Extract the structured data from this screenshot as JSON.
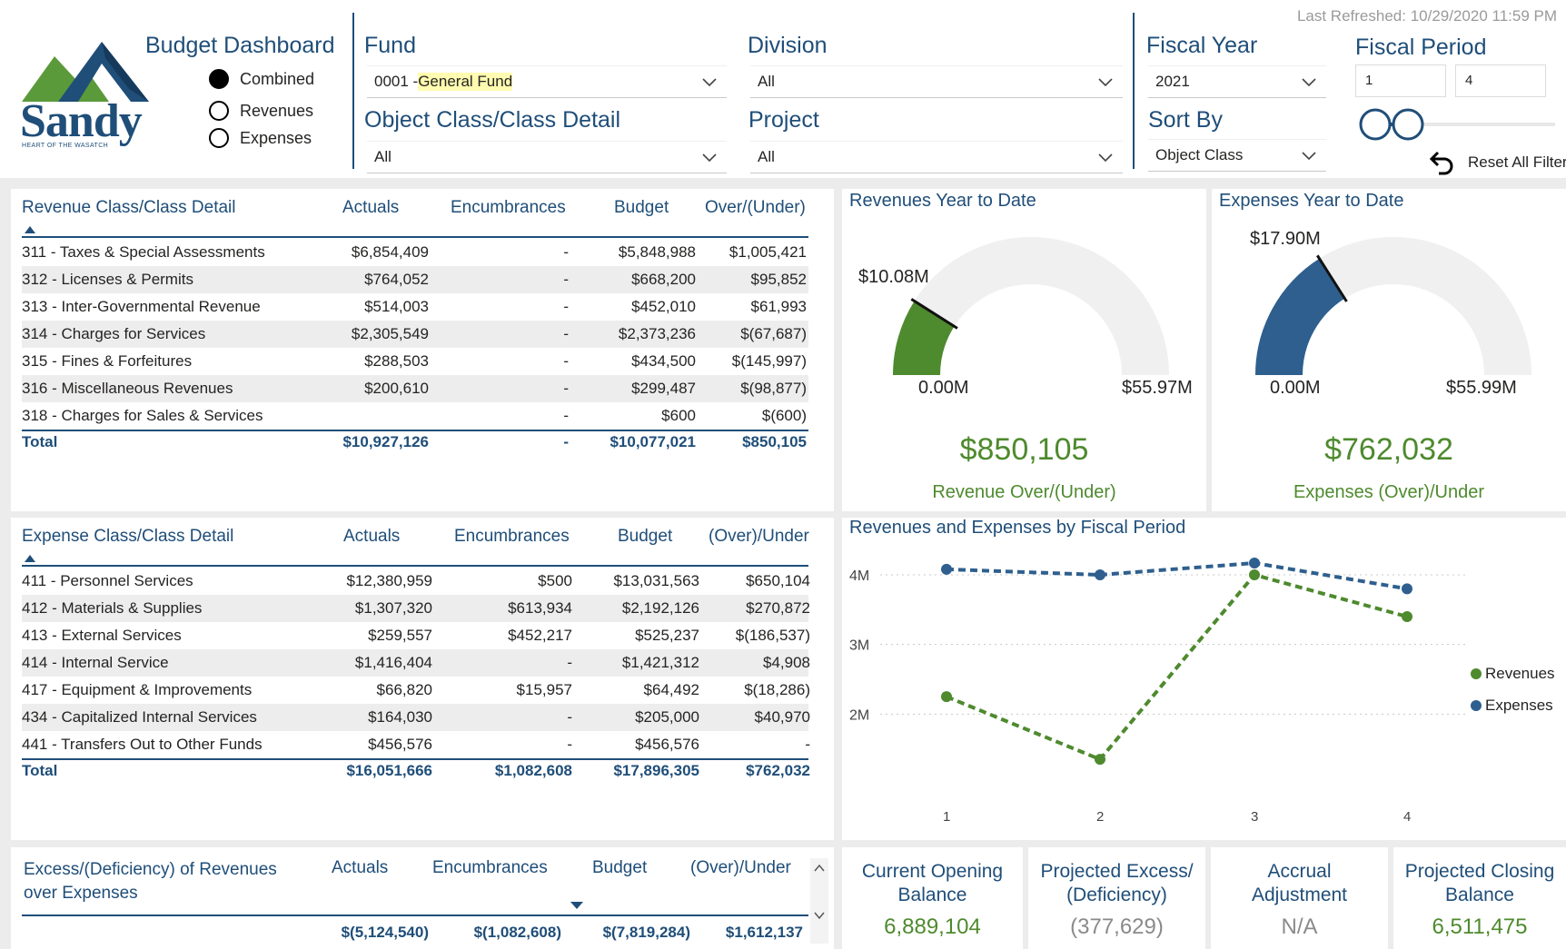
{
  "header": {
    "logo_text": "Sandy",
    "logo_tagline": "HEART OF THE WASATCH",
    "dashboard_title": "Budget Dashboard",
    "view_options": [
      {
        "label": "Combined",
        "selected": true
      },
      {
        "label": "Revenues",
        "selected": false
      },
      {
        "label": "Expenses",
        "selected": false
      }
    ],
    "last_refreshed": "Last Refreshed: 10/29/2020 11:59 PM"
  },
  "filters": {
    "fund": {
      "label": "Fund",
      "value_prefix": "0001 - ",
      "value_highlight": "General Fund"
    },
    "division": {
      "label": "Division",
      "value": "All"
    },
    "object_class": {
      "label": "Object Class/Class Detail",
      "value": "All"
    },
    "project": {
      "label": "Project",
      "value": "All"
    },
    "fiscal_year": {
      "label": "Fiscal Year",
      "value": "2021"
    },
    "sort_by": {
      "label": "Sort By",
      "value": "Object Class"
    },
    "fiscal_period": {
      "label": "Fiscal Period",
      "from": "1",
      "to": "4"
    },
    "reset_label": "Reset All Filters"
  },
  "revenue_table": {
    "headers": [
      "Revenue Class/Class Detail",
      "Actuals",
      "Encumbrances",
      "Budget",
      "Over/(Under)"
    ],
    "rows": [
      [
        "311 - Taxes & Special Assessments",
        "$6,854,409",
        "-",
        "$5,848,988",
        "$1,005,421"
      ],
      [
        "312 - Licenses & Permits",
        "$764,052",
        "-",
        "$668,200",
        "$95,852"
      ],
      [
        "313 - Inter-Governmental Revenue",
        "$514,003",
        "-",
        "$452,010",
        "$61,993"
      ],
      [
        "314 - Charges for Services",
        "$2,305,549",
        "-",
        "$2,373,236",
        "$(67,687)"
      ],
      [
        "315 - Fines & Forfeitures",
        "$288,503",
        "-",
        "$434,500",
        "$(145,997)"
      ],
      [
        "316 - Miscellaneous Revenues",
        "$200,610",
        "-",
        "$299,487",
        "$(98,877)"
      ],
      [
        "318 - Charges for Sales & Services",
        "",
        "-",
        "$600",
        "$(600)"
      ]
    ],
    "total": [
      "Total",
      "$10,927,126",
      "-",
      "$10,077,021",
      "$850,105"
    ]
  },
  "expense_table": {
    "headers": [
      "Expense Class/Class Detail",
      "Actuals",
      "Encumbrances",
      "Budget",
      "(Over)/Under"
    ],
    "rows": [
      [
        "411 - Personnel Services",
        "$12,380,959",
        "$500",
        "$13,031,563",
        "$650,104"
      ],
      [
        "412 - Materials & Supplies",
        "$1,307,320",
        "$613,934",
        "$2,192,126",
        "$270,872"
      ],
      [
        "413 - External Services",
        "$259,557",
        "$452,217",
        "$525,237",
        "$(186,537)"
      ],
      [
        "414 - Internal Service",
        "$1,416,404",
        "-",
        "$1,421,312",
        "$4,908"
      ],
      [
        "417 - Equipment & Improvements",
        "$66,820",
        "$15,957",
        "$64,492",
        "$(18,286)"
      ],
      [
        "434 - Capitalized Internal Services",
        "$164,030",
        "-",
        "$205,000",
        "$40,970"
      ],
      [
        "441 - Transfers Out to Other Funds",
        "$456,576",
        "-",
        "$456,576",
        "-"
      ]
    ],
    "total": [
      "Total",
      "$16,051,666",
      "$1,082,608",
      "$17,896,305",
      "$762,032"
    ]
  },
  "excess_table": {
    "title_line1": "Excess/(Deficiency) of Revenues",
    "title_line2": "over Expenses",
    "headers": [
      "Actuals",
      "Encumbrances",
      "Budget",
      "(Over)/Under"
    ],
    "total": [
      "$(5,124,540)",
      "$(1,082,608)",
      "$(7,819,284)",
      "$1,612,137"
    ]
  },
  "revenue_gauge": {
    "title": "Revenues Year to Date",
    "value_label": "$10.08M",
    "min_label": "0.00M",
    "max_label": "$55.97M",
    "value": 10.08,
    "max": 55.97,
    "target": 10.08,
    "big_value": "$850,105",
    "sub_label": "Revenue Over/(Under)",
    "color": "#4e8a2e"
  },
  "expense_gauge": {
    "title": "Expenses Year to Date",
    "value_label": "$17.90M",
    "min_label": "0.00M",
    "max_label": "$55.99M",
    "value": 17.9,
    "max": 55.99,
    "target": 17.9,
    "big_value": "$762,032",
    "sub_label": "Expenses (Over)/Under",
    "color": "#2e5f8e"
  },
  "line_chart": {
    "title": "Revenues and Expenses by Fiscal Period",
    "y_ticks": [
      "4M",
      "3M",
      "2M"
    ],
    "x_ticks": [
      "1",
      "2",
      "3",
      "4"
    ],
    "legend": [
      "Revenues",
      "Expenses"
    ]
  },
  "chart_data": {
    "type": "line",
    "title": "Revenues and Expenses by Fiscal Period",
    "x": [
      1,
      2,
      3,
      4
    ],
    "ylim": [
      1.3,
      4.3
    ],
    "series": [
      {
        "name": "Revenues",
        "values": [
          2.25,
          1.35,
          4.0,
          3.4
        ],
        "color": "#4e8a2e"
      },
      {
        "name": "Expenses",
        "values": [
          4.08,
          4.0,
          4.17,
          3.8
        ],
        "color": "#2e5f8e"
      }
    ],
    "legend": "right"
  },
  "cards": [
    {
      "title_line1": "Current Opening",
      "title_line2": "Balance",
      "value": "6,889,104",
      "color": "#4e8a2e"
    },
    {
      "title_line1": "Projected Excess/",
      "title_line2": "(Deficiency)",
      "value": "(377,629)",
      "color": "#8a8a8a"
    },
    {
      "title_line1": "Accrual",
      "title_line2": "Adjustment",
      "value": "N/A",
      "color": "#8a8a8a"
    },
    {
      "title_line1": "Projected Closing",
      "title_line2": "Balance",
      "value": "6,511,475",
      "color": "#4e8a2e"
    }
  ]
}
